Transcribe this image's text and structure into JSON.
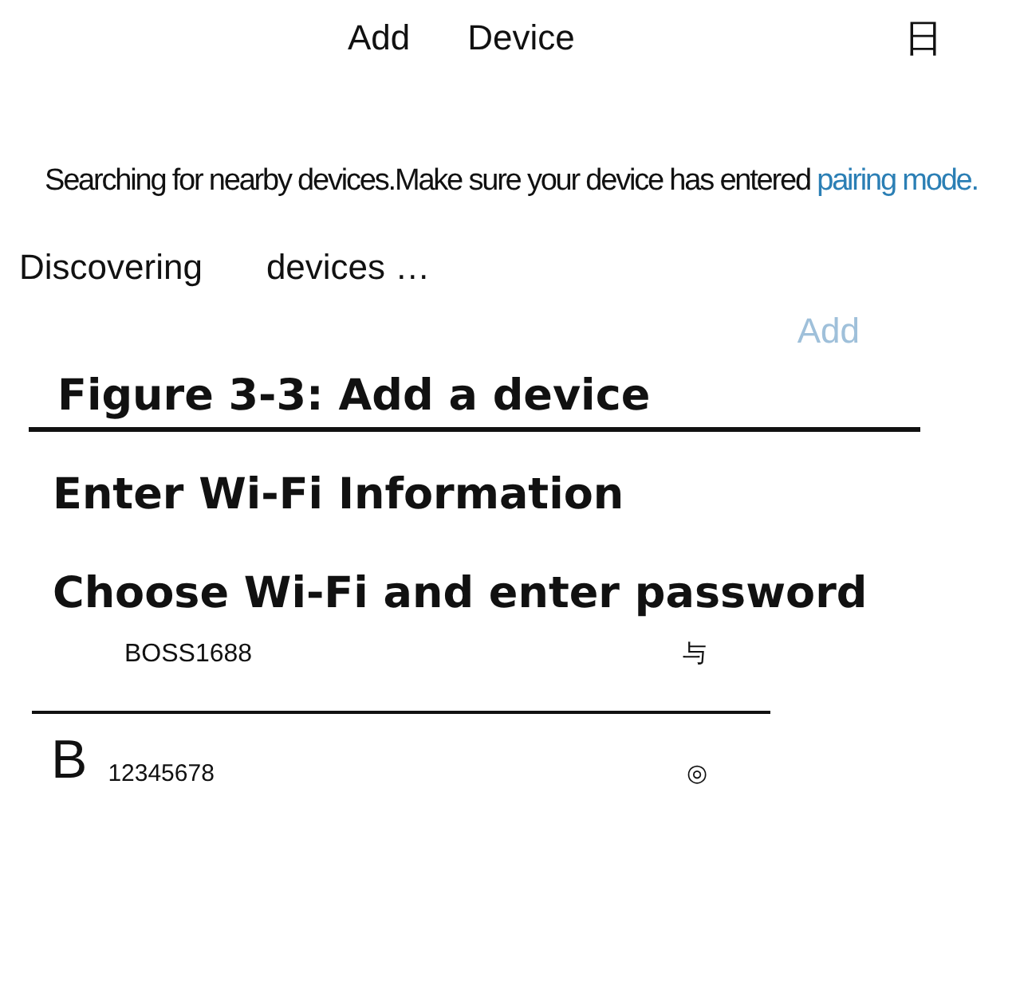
{
  "header": {
    "title_words": [
      "Add",
      "Device"
    ],
    "icon_glyph": "日"
  },
  "message": {
    "text": "Searching for nearby devices.Make sure your device has entered",
    "link": "pairing mode."
  },
  "status_words": [
    "Discovering",
    "devices …"
  ],
  "add_button": {
    "label": "Add",
    "disabled": true
  },
  "caption": "Figure 3-3: Add a device",
  "headings": [
    "Enter Wi-Fi Information",
    "Choose Wi-Fi and enter password"
  ],
  "wifi_field": {
    "value": "BOSS1688",
    "icon_glyph": "与"
  },
  "password_field": {
    "prefix": "B",
    "value": "12345678",
    "icon_glyph": "◎"
  }
}
